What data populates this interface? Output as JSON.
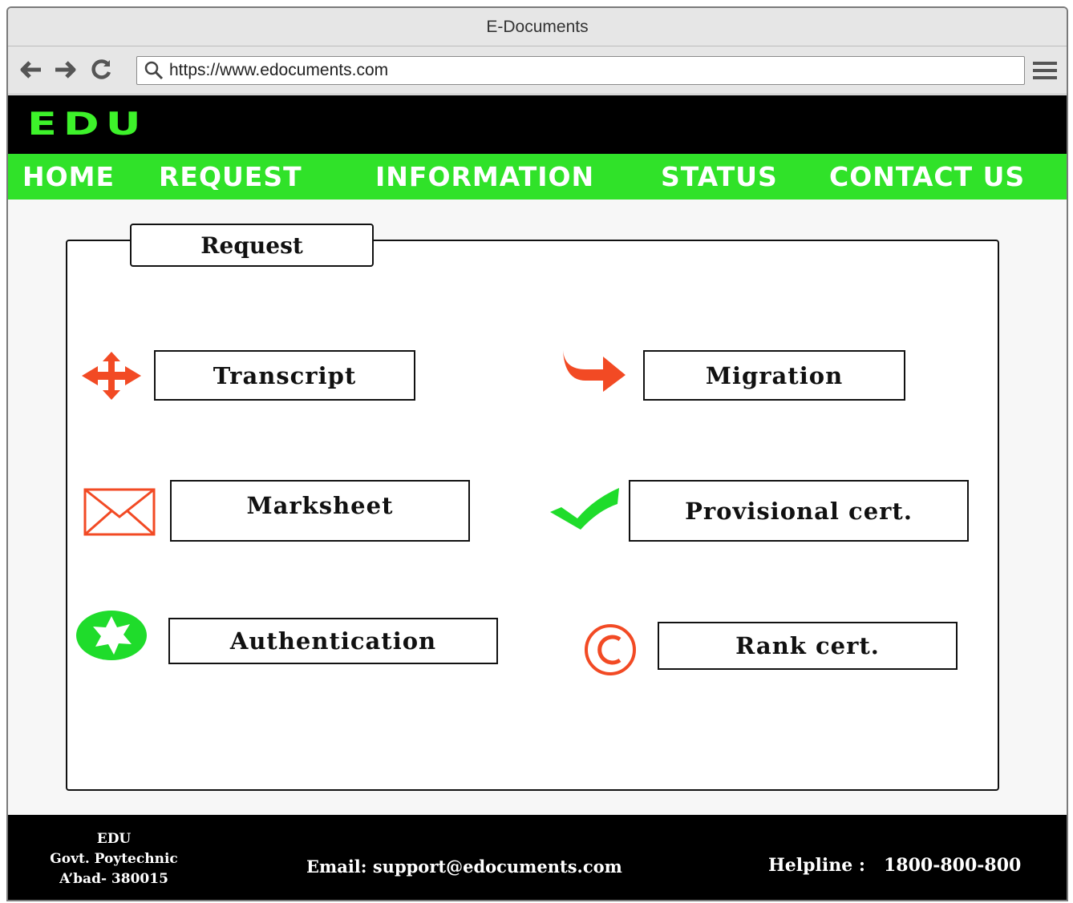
{
  "window": {
    "title": "E-Documents"
  },
  "browser": {
    "url": "https://www.edocuments.com",
    "icons": [
      "back-arrow-icon",
      "forward-arrow-icon",
      "reload-icon",
      "search-icon",
      "hamburger-menu-icon"
    ]
  },
  "site": {
    "logo": "EDU",
    "nav": [
      "HOME",
      "REQUEST",
      "INFORMATION",
      "STATUS",
      "CONTACT US"
    ],
    "colors": {
      "accent_green": "#30e229",
      "icon_red": "#f24a24",
      "logo_green": "#3df22a"
    }
  },
  "request_panel": {
    "title": "Request",
    "items": [
      {
        "label": "Transcript",
        "icon": "move-arrows-icon"
      },
      {
        "label": "Migration",
        "icon": "curved-arrow-icon"
      },
      {
        "label": "Marksheet",
        "icon": "envelope-icon"
      },
      {
        "label": "Provisional cert.",
        "icon": "checkmark-icon"
      },
      {
        "label": "Authentication",
        "icon": "star-badge-icon"
      },
      {
        "label": "Rank cert.",
        "icon": "copyright-icon"
      }
    ]
  },
  "footer": {
    "address": [
      "EDU",
      "Govt. Poytechnic",
      "A’bad- 380015"
    ],
    "email": "Email: support@edocuments.com",
    "helpline_label": "Helpline :",
    "helpline_number": "1800-800-800"
  }
}
